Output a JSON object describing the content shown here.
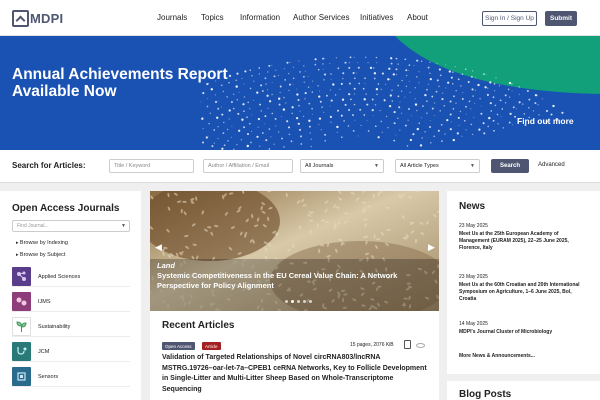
{
  "header": {
    "logo_text": "MDPI",
    "nav": [
      "Journals",
      "Topics",
      "Information",
      "Author Services",
      "Initiatives",
      "About"
    ],
    "sign_in_label": "Sign In / Sign Up",
    "submit_label": "Submit"
  },
  "banner": {
    "title": "Annual Achievements Report Available Now",
    "cta": "Find out more",
    "colors": {
      "background": "#1a52b3",
      "accent": "#11a07a"
    }
  },
  "search": {
    "label": "Search for Articles:",
    "title_placeholder": "Title / Keyword",
    "author_placeholder": "Author / Affiliation / Email",
    "journal_select": "All Journals",
    "type_select": "All Article Types",
    "button": "Search",
    "advanced": "Advanced"
  },
  "journals_sidebar": {
    "title": "Open Access Journals",
    "find_placeholder": "Find Journal...",
    "browse_indexing": "Browse by Indexing",
    "browse_subject": "Browse by Subject",
    "items": [
      {
        "name": "Applied Sciences",
        "color": "#5a3d8a",
        "icon": "molecule-icon"
      },
      {
        "name": "IJMS",
        "color": "#8c3d7a",
        "icon": "cells-icon"
      },
      {
        "name": "Sustainability",
        "color": "#ffffff",
        "icon": "leaf-icon"
      },
      {
        "name": "JCM",
        "color": "#2a7a7a",
        "icon": "stethoscope-icon"
      },
      {
        "name": "Sensors",
        "color": "#2a6a8a",
        "icon": "sensor-icon"
      }
    ]
  },
  "hero": {
    "journal": "Land",
    "title": "Systemic Competitiveness in the EU Cereal Value Chain: A Network Perspective for Policy Alignment",
    "slide_count": 5,
    "active_slide": 1
  },
  "recent": {
    "title": "Recent Articles",
    "tags": [
      {
        "label": "Open Access",
        "color": "#4f5671"
      },
      {
        "label": "Article",
        "color": "#a52020"
      }
    ],
    "meta": "15 pages, 2076 KiB",
    "article_title": "Validation of Targeted Relationships of Novel circRNA803/lncRNA MSTRG.19726–oar-let-7a–CPEB1 ceRNA Networks, Key to Follicle Development in Single-Litter and Multi-Litter Sheep Based on Whole-Transcriptome Sequencing"
  },
  "news": {
    "title": "News",
    "items": [
      {
        "date": "23 May 2025",
        "text": "Meet Us at the 25th European Academy of Management (EURAM 2025), 22–25 June 2025, Florence, Italy"
      },
      {
        "date": "23 May 2025",
        "text": "Meet Us at the 60th Croatian and 20th International Symposium on Agriculture, 1–6 June 2025, Bol, Croatia"
      },
      {
        "date": "14 May 2025",
        "text": "MDPI's Journal Cluster of Microbiology"
      }
    ],
    "more": "More News & Announcements..."
  },
  "blog": {
    "title": "Blog Posts"
  }
}
